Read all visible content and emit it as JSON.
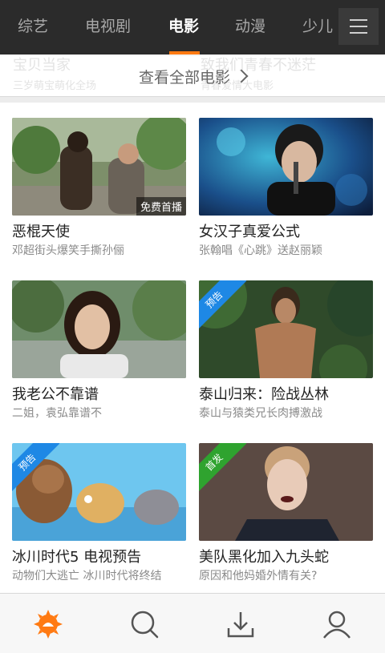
{
  "tabs": [
    {
      "label": "综艺"
    },
    {
      "label": "电视剧"
    },
    {
      "label": "电影"
    },
    {
      "label": "动漫"
    },
    {
      "label": "少儿"
    }
  ],
  "active_tab": "电影",
  "ghost_text": {
    "left_title": "宝贝当家",
    "left_sub": "三岁萌宝萌化全场",
    "right_title": "致我们青春不迷茫",
    "right_sub": "青春爱情大电影"
  },
  "view_all_label": "查看全部电影",
  "cards": [
    {
      "title": "恶棍天使",
      "subtitle": "邓超街头爆笑手撕孙俪",
      "badge": "免费首播"
    },
    {
      "title": "女汉子真爱公式",
      "subtitle": "张翰唱《心跳》送赵丽颖",
      "badge": ""
    },
    {
      "title": "我老公不靠谱",
      "subtitle": "二姐，袁弘靠谱不",
      "badge": ""
    },
    {
      "title": "泰山归来：险战丛林",
      "subtitle": "泰山与猿类兄长肉搏激战",
      "ribbon": "预告"
    },
    {
      "title": "冰川时代5 电视预告",
      "subtitle": "动物们大逃亡 冰川时代将终结",
      "ribbon": "预告"
    },
    {
      "title": "美队黑化加入九头蛇",
      "subtitle": "原因和他妈婚外情有关?",
      "ribbon": "首发"
    }
  ],
  "colors": {
    "accent": "#ff7a12",
    "ribbon_blue": "#1e88e5",
    "ribbon_green": "#2fa32f",
    "topbar": "#2b2b2b"
  },
  "bottom_nav": [
    {
      "icon": "home-sun-icon"
    },
    {
      "icon": "search-icon"
    },
    {
      "icon": "download-icon"
    },
    {
      "icon": "user-icon"
    }
  ]
}
